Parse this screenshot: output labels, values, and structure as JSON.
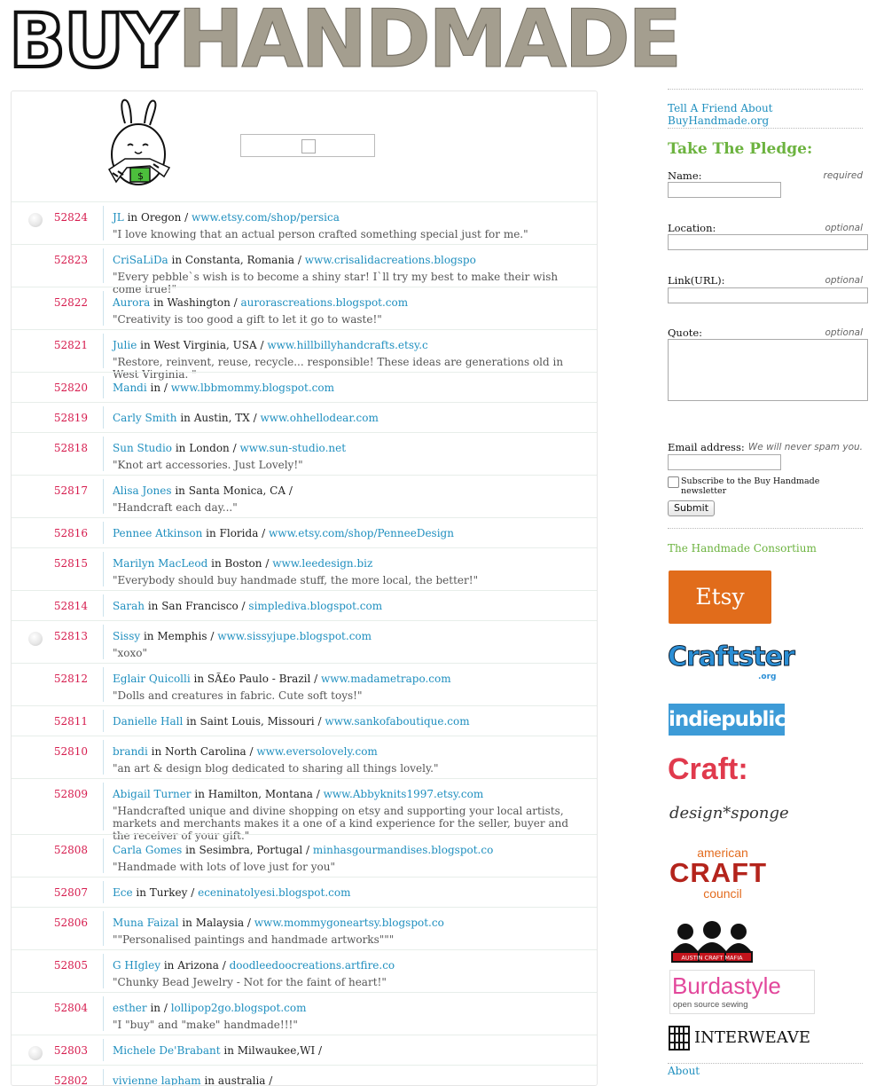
{
  "header": {
    "logo_part1": "BUY",
    "logo_part2": "HANDMADE"
  },
  "pledges": [
    {
      "num": "52824",
      "name": "JL",
      "location": "Oregon",
      "link": "www.etsy.com/shop/persica",
      "quote": "\"I love knowing that an actual person crafted something special just for me.\"",
      "avatar": true
    },
    {
      "num": "52823",
      "name": "CriSaLiDa",
      "location": "Constanta, Romania",
      "link": "www.crisalidacreations.blogspo",
      "quote": "\"Every pebble`s wish is to become a shiny star! I`ll try my best to make their wish come true!\""
    },
    {
      "num": "52822",
      "name": "Aurora",
      "location": "Washington",
      "link": "aurorascreations.blogspot.com",
      "quote": "\"Creativity is too good a gift to let it go to waste!\""
    },
    {
      "num": "52821",
      "name": "Julie",
      "location": "West Virginia, USA",
      "link": "www.hillbillyhandcrafts.etsy.c",
      "quote": "\"Restore, reinvent, reuse, recycle... responsible! These ideas are generations old in West Virginia. \""
    },
    {
      "num": "52820",
      "name": "Mandi",
      "location": "",
      "link": "www.lbbmommy.blogspot.com",
      "quote": ""
    },
    {
      "num": "52819",
      "name": "Carly Smith",
      "location": "Austin, TX",
      "link": "www.ohhellodear.com",
      "quote": ""
    },
    {
      "num": "52818",
      "name": "Sun Studio",
      "location": "London",
      "link": "www.sun-studio.net",
      "quote": "\"Knot art accessories. Just Lovely!\""
    },
    {
      "num": "52817",
      "name": "Alisa Jones",
      "location": "Santa Monica, CA",
      "link": "",
      "quote": "\"Handcraft each day...\""
    },
    {
      "num": "52816",
      "name": "Pennee Atkinson",
      "location": "Florida",
      "link": "www.etsy.com/shop/PenneeDesign",
      "quote": ""
    },
    {
      "num": "52815",
      "name": "Marilyn MacLeod",
      "location": "Boston",
      "link": "www.leedesign.biz",
      "quote": "\"Everybody should buy handmade stuff, the more local, the better!\""
    },
    {
      "num": "52814",
      "name": "Sarah",
      "location": "San Francisco",
      "link": "simplediva.blogspot.com",
      "quote": ""
    },
    {
      "num": "52813",
      "name": "Sissy",
      "location": "Memphis",
      "link": "www.sissyjupe.blogspot.com",
      "quote": "\"xoxo\"",
      "avatar": true
    },
    {
      "num": "52812",
      "name": "Eglair Quicolli",
      "location": "SÃ£o Paulo - Brazil",
      "link": "www.madametrapo.com",
      "quote": "\"Dolls and creatures in fabric. Cute soft toys!\""
    },
    {
      "num": "52811",
      "name": "Danielle Hall",
      "location": "Saint Louis, Missouri",
      "link": "www.sankofaboutique.com",
      "quote": ""
    },
    {
      "num": "52810",
      "name": "brandi",
      "location": "North Carolina",
      "link": "www.eversolovely.com",
      "quote": "\"an art & design blog dedicated to sharing all things lovely.\""
    },
    {
      "num": "52809",
      "name": "Abigail Turner",
      "location": "Hamilton, Montana",
      "link": "www.Abbyknits1997.etsy.com",
      "quote": "\"Handcrafted unique and divine shopping on etsy and supporting your local artists, markets and merchants makes it a one of a kind experience for the seller, buyer and the receiver of your gift.\""
    },
    {
      "num": "52808",
      "name": "Carla Gomes",
      "location": "Sesimbra, Portugal",
      "link": "minhasgourmandises.blogspot.co",
      "quote": "\"Handmade with lots of love just for you\""
    },
    {
      "num": "52807",
      "name": "Ece",
      "location": "Turkey",
      "link": "eceninatolyesi.blogspot.com",
      "quote": ""
    },
    {
      "num": "52806",
      "name": "Muna Faizal",
      "location": "Malaysia",
      "link": "www.mommygoneartsy.blogspot.co",
      "quote": "\"\"Personalised paintings and handmade artworks\"\"\""
    },
    {
      "num": "52805",
      "name": "G HIgley",
      "location": "Arizona",
      "link": "doodleedoocreations.artfire.co",
      "quote": "\"Chunky Bead Jewelry - Not for the faint of heart!\""
    },
    {
      "num": "52804",
      "name": "esther",
      "location": "",
      "link": "lollipop2go.blogspot.com",
      "quote": "\"I \"buy\" and \"make\" handmade!!!\""
    },
    {
      "num": "52803",
      "name": "Michele De'Brabant",
      "location": "Milwaukee,WI",
      "link": "",
      "quote": "",
      "avatar": true
    },
    {
      "num": "52802",
      "name": "vivienne lapham",
      "location": "australia",
      "link": "",
      "quote": ""
    }
  ],
  "sidebar": {
    "tell_friend": "Tell A Friend About BuyHandmade.org",
    "pledge_title": "Take The Pledge:",
    "name_label": "Name:",
    "name_hint": "required",
    "location_label": "Location:",
    "location_hint": "optional",
    "link_label": "Link(URL):",
    "link_hint": "optional",
    "quote_label": "Quote:",
    "quote_hint": "optional",
    "email_label": "Email address:",
    "email_hint": "We will never spam you.",
    "subscribe_label": "Subscribe to the Buy Handmade newsletter",
    "submit_label": "Submit",
    "consortium_title": "The Handmade Consortium",
    "etsy": "Etsy",
    "craftster": "Craftster",
    "craftster_org": ".org",
    "indiepublic": "indiepublic",
    "craft": "Craft:",
    "designsponge": "design*sponge",
    "acc1": "american",
    "acc2": "CRAFT",
    "acc3": "council",
    "mafia": "AUSTIN CRAFT MAFIA",
    "burda": "Burdastyle",
    "burda_sub": "open source sewing",
    "interweave": "INTERWEAVE",
    "about": "About"
  }
}
